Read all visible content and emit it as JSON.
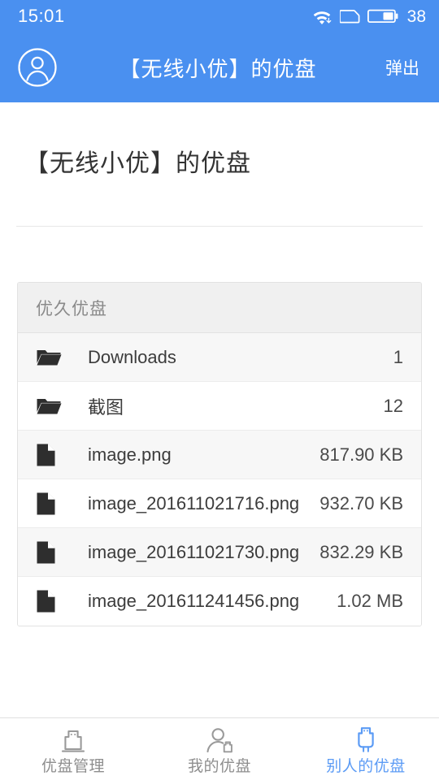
{
  "status_bar": {
    "time": "15:01",
    "battery_percent": "38",
    "icons": [
      "wifi-download-icon",
      "sim-card-icon",
      "battery-icon"
    ]
  },
  "app_bar": {
    "avatar_icon": "user-avatar-icon",
    "title": "【无线小优】的优盘",
    "eject_label": "弹出"
  },
  "page": {
    "title": "【无线小优】的优盘"
  },
  "card": {
    "header": "优久优盘",
    "rows": [
      {
        "icon": "folder-icon",
        "name": "Downloads",
        "meta": "1"
      },
      {
        "icon": "folder-icon",
        "name": "截图",
        "meta": "12"
      },
      {
        "icon": "document-icon",
        "name": "image.png",
        "meta": "817.90 KB"
      },
      {
        "icon": "document-icon",
        "name": "image_201611021716.png",
        "meta": "932.70 KB"
      },
      {
        "icon": "document-icon",
        "name": "image_201611021730.png",
        "meta": "832.29 KB"
      },
      {
        "icon": "document-icon",
        "name": "image_201611241456.png",
        "meta": "1.02 MB"
      }
    ]
  },
  "bottom_nav": {
    "tabs": [
      {
        "label": "优盘管理",
        "icon": "usb-drive-icon",
        "active": false
      },
      {
        "label": "我的优盘",
        "icon": "person-with-usb-icon",
        "active": false
      },
      {
        "label": "别人的优盘",
        "icon": "usb-plug-icon",
        "active": true
      }
    ]
  },
  "colors": {
    "brand_blue": "#4a90f0",
    "active_tab": "#5b9bf5",
    "card_header_bg": "#f0f0f0",
    "row_shade_bg": "#f7f7f7",
    "text_primary": "#333333",
    "text_muted": "#8e8e8e"
  }
}
